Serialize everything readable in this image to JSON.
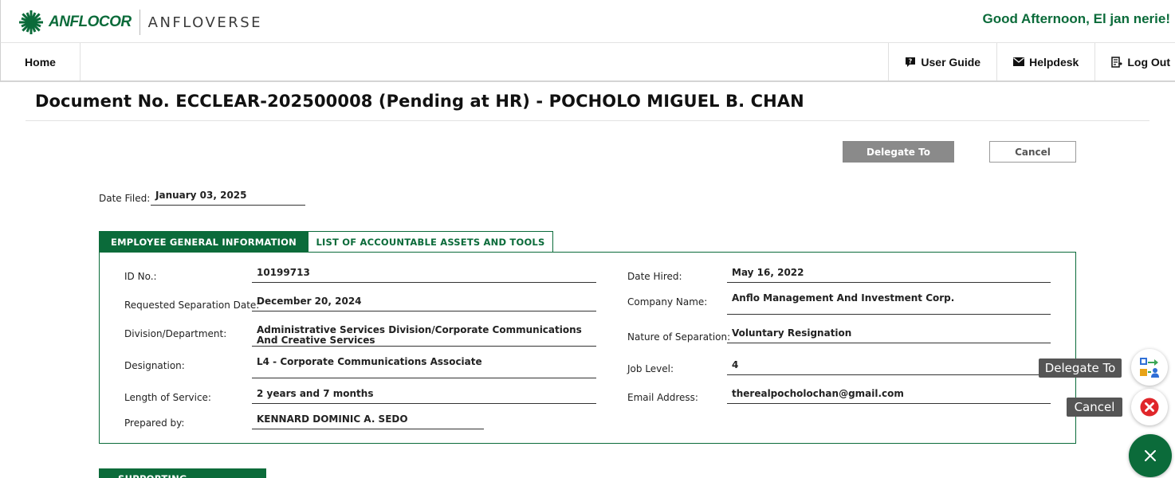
{
  "header": {
    "brand": "ANFLOCOR",
    "sub_brand": "ANFLOVERSE",
    "greeting": "Good Afternoon, El jan nerie!"
  },
  "nav": {
    "home": "Home",
    "user_guide": "User Guide",
    "helpdesk": "Helpdesk",
    "logout": "Log Out"
  },
  "document": {
    "title": "Document No. ECCLEAR-202500008 (Pending at HR) - POCHOLO MIGUEL B. CHAN"
  },
  "actions": {
    "delegate": "Delegate To",
    "cancel": "Cancel"
  },
  "date_filed": {
    "label": "Date Filed:",
    "value": "January 03, 2025"
  },
  "tabs": [
    {
      "label": "EMPLOYEE GENERAL INFORMATION",
      "active": true
    },
    {
      "label": "LIST OF ACCOUNTABLE ASSETS AND TOOLS",
      "active": false
    }
  ],
  "employee": {
    "id_label": "ID No.:",
    "id_value": "10199713",
    "sep_date_label": "Requested Separation Date:",
    "sep_date_value": "December 20, 2024",
    "division_label": "Division/Department:",
    "division_value": "Administrative Services Division/Corporate Communications And Creative Services",
    "designation_label": "Designation:",
    "designation_value": "L4 - Corporate Communications Associate",
    "los_label": "Length of Service:",
    "los_value": "2 years and 7 months",
    "prepared_label": "Prepared by:",
    "prepared_value": "KENNARD DOMINIC A. SEDO",
    "hired_label": "Date Hired:",
    "hired_value": "May 16, 2022",
    "company_label": "Company Name:",
    "company_value": "Anflo Management And Investment Corp.",
    "nature_label": "Nature of Separation:",
    "nature_value": "Voluntary Resignation",
    "level_label": "Job Level:",
    "level_value": "4",
    "email_label": "Email Address:",
    "email_value": "therealpocholochan@gmail.com"
  },
  "supporting": {
    "label": "SUPPORTING DOCUMENTS"
  },
  "fab": {
    "delegate_tip": "Delegate To",
    "cancel_tip": "Cancel"
  },
  "colors": {
    "brand_green": "#0b6b3a",
    "button_gray": "#8a8a8a",
    "cancel_red": "#e0262a"
  }
}
